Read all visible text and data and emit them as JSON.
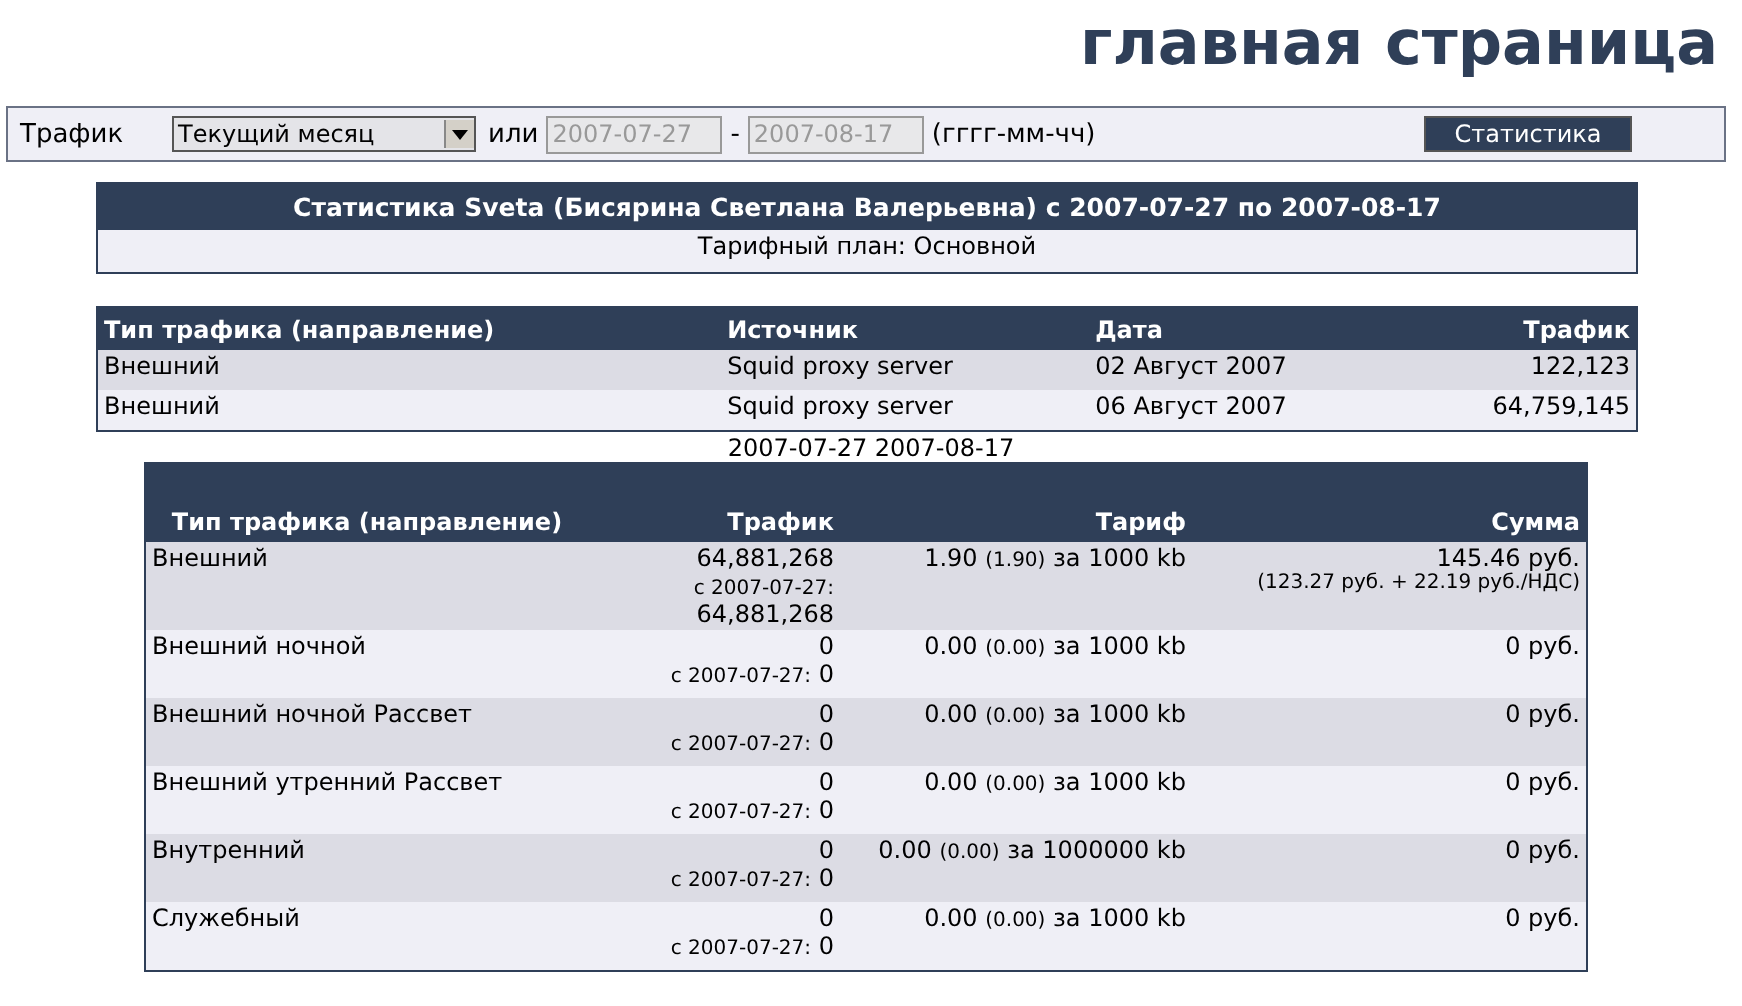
{
  "page_title": "главная страница",
  "filter": {
    "label": "Трафик",
    "period": "Текущий месяц",
    "or_label": "или",
    "date_from": "2007-07-27",
    "dash": "-",
    "date_to": "2007-08-17",
    "format_hint": "(гггг-мм-чч)",
    "button": "Статистика"
  },
  "summary": {
    "title": "Статистика Sveta (Бисярина Светлана Валерьевна) с 2007-07-27 по 2007-08-17",
    "plan": "Тарифный план: Основной"
  },
  "sessions": {
    "columns": [
      "Тип трафика (направление)",
      "Источник",
      "Дата",
      "Трафик"
    ],
    "rows": [
      {
        "type": "Внешний",
        "source": "Squid proxy server",
        "date": "02 Август 2007",
        "traffic": "122,123"
      },
      {
        "type": "Внешний",
        "source": "Squid proxy server",
        "date": "06 Август 2007",
        "traffic": "64,759,145"
      }
    ]
  },
  "period_caption": "2007-07-27 2007-08-17",
  "totals": {
    "columns": [
      "Тип трафика (направление)",
      "Трафик",
      "Тариф",
      "Сумма"
    ],
    "rows": [
      {
        "type": "Внешний",
        "traffic": "64,881,268",
        "since_label": "с 2007-07-27:",
        "since_value": "64,881,268",
        "rate": "1.90",
        "rate_sub": "(1.90)",
        "per": "за 1000 kb",
        "sum": "145.46 руб.",
        "sum_note": "(123.27 руб. + 22.19 руб./НДС)"
      },
      {
        "type": "Внешний ночной",
        "traffic": "0",
        "since_label": "с 2007-07-27:",
        "since_value": "0",
        "rate": "0.00",
        "rate_sub": "(0.00)",
        "per": "за 1000 kb",
        "sum": "0 руб."
      },
      {
        "type": "Внешний ночной Рассвет",
        "traffic": "0",
        "since_label": "с 2007-07-27:",
        "since_value": "0",
        "rate": "0.00",
        "rate_sub": "(0.00)",
        "per": "за 1000 kb",
        "sum": "0 руб."
      },
      {
        "type": "Внешний утренний Рассвет",
        "traffic": "0",
        "since_label": "с 2007-07-27:",
        "since_value": "0",
        "rate": "0.00",
        "rate_sub": "(0.00)",
        "per": "за 1000 kb",
        "sum": "0 руб."
      },
      {
        "type": "Внутренний",
        "traffic": "0",
        "since_label": "с 2007-07-27:",
        "since_value": "0",
        "rate": "0.00",
        "rate_sub": "(0.00)",
        "per": "за 1000000 kb",
        "sum": "0 руб."
      },
      {
        "type": "Служебный",
        "traffic": "0",
        "since_label": "с 2007-07-27:",
        "since_value": "0",
        "rate": "0.00",
        "rate_sub": "(0.00)",
        "per": "за 1000 kb",
        "sum": "0 руб."
      }
    ]
  }
}
